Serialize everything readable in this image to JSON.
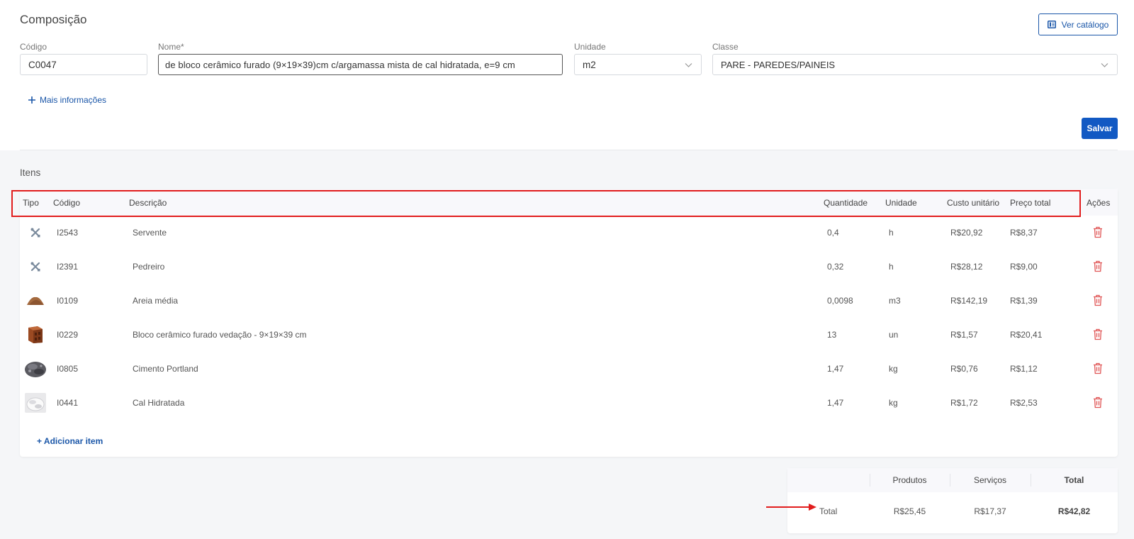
{
  "header": {
    "title": "Composição",
    "catalog_button": "Ver catálogo"
  },
  "form": {
    "code_label": "Código",
    "code_value": "C0047",
    "name_label": "Nome*",
    "name_value": "de bloco cerâmico furado (9×19×39)cm c/argamassa mista de cal hidratada, e=9 cm",
    "unit_label": "Unidade",
    "unit_value": "m2",
    "class_label": "Classe",
    "class_value": "PARE - PAREDES/PAINEIS",
    "more_info": "Mais informações",
    "save_button": "Salvar"
  },
  "items": {
    "title": "Itens",
    "columns": {
      "tipo": "Tipo",
      "codigo": "Código",
      "descricao": "Descrição",
      "quantidade": "Quantidade",
      "unidade": "Unidade",
      "custo_unitario": "Custo unitário",
      "preco_total": "Preço total",
      "acoes": "Ações"
    },
    "rows": [
      {
        "icon": "tools-icon",
        "code": "I2543",
        "description": "Servente",
        "quantity": "0,4",
        "unit": "h",
        "unit_cost": "R$20,92",
        "total_price": "R$8,37"
      },
      {
        "icon": "tools-icon",
        "code": "I2391",
        "description": "Pedreiro",
        "quantity": "0,32",
        "unit": "h",
        "unit_cost": "R$28,12",
        "total_price": "R$9,00"
      },
      {
        "icon": "sand-icon",
        "code": "I0109",
        "description": "Areia média",
        "quantity": "0,0098",
        "unit": "m3",
        "unit_cost": "R$142,19",
        "total_price": "R$1,39"
      },
      {
        "icon": "brick-icon",
        "code": "I0229",
        "description": "Bloco cerâmico furado vedação - 9×19×39 cm",
        "quantity": "13",
        "unit": "un",
        "unit_cost": "R$1,57",
        "total_price": "R$20,41"
      },
      {
        "icon": "cement-icon",
        "code": "I0805",
        "description": "Cimento Portland",
        "quantity": "1,47",
        "unit": "kg",
        "unit_cost": "R$0,76",
        "total_price": "R$1,12"
      },
      {
        "icon": "lime-icon",
        "code": "I0441",
        "description": "Cal Hidratada",
        "quantity": "1,47",
        "unit": "kg",
        "unit_cost": "R$1,72",
        "total_price": "R$2,53"
      }
    ],
    "add_item": "+ Adicionar item"
  },
  "totals": {
    "col_products": "Produtos",
    "col_services": "Serviços",
    "col_total": "Total",
    "row_label": "Total",
    "products": "R$25,45",
    "services": "R$17,37",
    "total": "R$42,82"
  },
  "colors": {
    "accent": "#1259c3",
    "link": "#1a56a8",
    "danger": "#e11d1d",
    "trash": "#e05555"
  }
}
